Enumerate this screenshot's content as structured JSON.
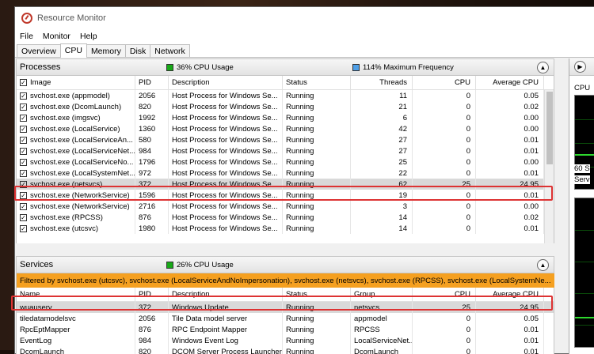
{
  "window": {
    "title": "Resource Monitor"
  },
  "menu": [
    "File",
    "Monitor",
    "Help"
  ],
  "tabs": [
    "Overview",
    "CPU",
    "Memory",
    "Disk",
    "Network"
  ],
  "processes": {
    "title": "Processes",
    "cpu_usage": "36% CPU Usage",
    "max_freq": "114% Maximum Frequency",
    "columns": [
      "Image",
      "PID",
      "Description",
      "Status",
      "Threads",
      "CPU",
      "Average CPU"
    ],
    "rows": [
      {
        "image": "svchost.exe (appmodel)",
        "pid": "2056",
        "desc": "Host Process for Windows Se...",
        "status": "Running",
        "threads": "11",
        "cpu": "0",
        "avg": "0.05"
      },
      {
        "image": "svchost.exe (DcomLaunch)",
        "pid": "820",
        "desc": "Host Process for Windows Se...",
        "status": "Running",
        "threads": "21",
        "cpu": "0",
        "avg": "0.02"
      },
      {
        "image": "svchost.exe (imgsvc)",
        "pid": "1992",
        "desc": "Host Process for Windows Se...",
        "status": "Running",
        "threads": "6",
        "cpu": "0",
        "avg": "0.00"
      },
      {
        "image": "svchost.exe (LocalService)",
        "pid": "1360",
        "desc": "Host Process for Windows Se...",
        "status": "Running",
        "threads": "42",
        "cpu": "0",
        "avg": "0.00"
      },
      {
        "image": "svchost.exe (LocalServiceAn...",
        "pid": "580",
        "desc": "Host Process for Windows Se...",
        "status": "Running",
        "threads": "27",
        "cpu": "0",
        "avg": "0.01"
      },
      {
        "image": "svchost.exe (LocalServiceNet...",
        "pid": "984",
        "desc": "Host Process for Windows Se...",
        "status": "Running",
        "threads": "27",
        "cpu": "0",
        "avg": "0.01"
      },
      {
        "image": "svchost.exe (LocalServiceNo...",
        "pid": "1796",
        "desc": "Host Process for Windows Se...",
        "status": "Running",
        "threads": "25",
        "cpu": "0",
        "avg": "0.00"
      },
      {
        "image": "svchost.exe (LocalSystemNet...",
        "pid": "972",
        "desc": "Host Process for Windows Se...",
        "status": "Running",
        "threads": "22",
        "cpu": "0",
        "avg": "0.01"
      },
      {
        "image": "svchost.exe (netsvcs)",
        "pid": "372",
        "desc": "Host Process for Windows Se...",
        "status": "Running",
        "threads": "62",
        "cpu": "25",
        "avg": "24.95"
      },
      {
        "image": "svchost.exe (NetworkService)",
        "pid": "1596",
        "desc": "Host Process for Windows Se...",
        "status": "Running",
        "threads": "19",
        "cpu": "0",
        "avg": "0.01"
      },
      {
        "image": "svchost.exe (NetworkService)",
        "pid": "2716",
        "desc": "Host Process for Windows Se...",
        "status": "Running",
        "threads": "3",
        "cpu": "0",
        "avg": "0.00"
      },
      {
        "image": "svchost.exe (RPCSS)",
        "pid": "876",
        "desc": "Host Process for Windows Se...",
        "status": "Running",
        "threads": "14",
        "cpu": "0",
        "avg": "0.02"
      },
      {
        "image": "svchost.exe (utcsvc)",
        "pid": "1980",
        "desc": "Host Process for Windows Se...",
        "status": "Running",
        "threads": "14",
        "cpu": "0",
        "avg": "0.01"
      }
    ]
  },
  "services": {
    "title": "Services",
    "cpu_usage": "26% CPU Usage",
    "filter": "Filtered by svchost.exe (utcsvc), svchost.exe (LocalServiceAndNoImpersonation), svchost.exe (netsvcs), svchost.exe (RPCSS), svchost.exe (LocalSystemNe...",
    "columns": [
      "Name",
      "PID",
      "Description",
      "Status",
      "Group",
      "CPU",
      "Average CPU"
    ],
    "rows": [
      {
        "name": "wuauserv",
        "pid": "372",
        "desc": "Windows Update",
        "status": "Running",
        "group": "netsvcs",
        "cpu": "25",
        "avg": "24.95"
      },
      {
        "name": "tiledatamodelsvc",
        "pid": "2056",
        "desc": "Tile Data model server",
        "status": "Running",
        "group": "appmodel",
        "cpu": "0",
        "avg": "0.05"
      },
      {
        "name": "RpcEptMapper",
        "pid": "876",
        "desc": "RPC Endpoint Mapper",
        "status": "Running",
        "group": "RPCSS",
        "cpu": "0",
        "avg": "0.01"
      },
      {
        "name": "EventLog",
        "pid": "984",
        "desc": "Windows Event Log",
        "status": "Running",
        "group": "LocalServiceNet...",
        "cpu": "0",
        "avg": "0.01"
      },
      {
        "name": "DcomLaunch",
        "pid": "820",
        "desc": "DCOM Server Process Launcher",
        "status": "Running",
        "group": "DcomLaunch",
        "cpu": "0",
        "avg": "0.01"
      }
    ]
  },
  "right_pane": {
    "label": "CPU",
    "label2": "60 S",
    "label3": "Serv"
  },
  "colors": {
    "highlight": "#d33333",
    "filter_bar": "#f5a020",
    "usage_green": "#18a818",
    "freq_blue": "#4fa0e8"
  }
}
